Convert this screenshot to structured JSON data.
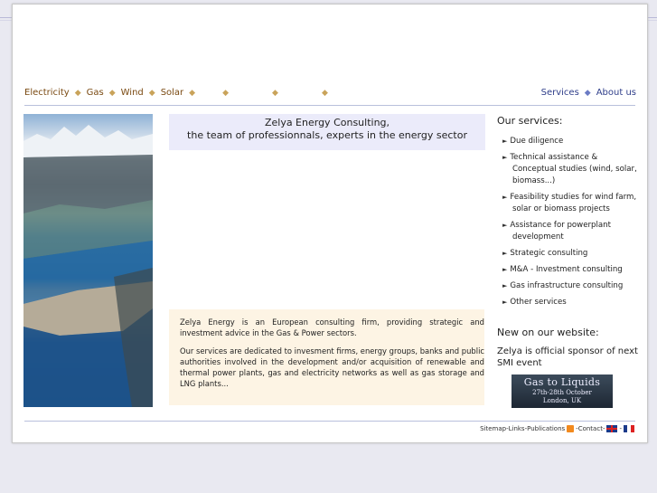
{
  "topnav": {
    "items": [
      "Electricity",
      "Gas",
      "Wind",
      "Solar"
    ]
  },
  "rightnav": {
    "services": "Services",
    "about": "About us"
  },
  "header": {
    "line1": "Zelya Energy Consulting,",
    "line2": "the team of professionnals, experts in the energy sector"
  },
  "intro": {
    "p1": "Zelya Energy is an European consulting firm, providing strategic and investment advice in the Gas & Power sectors.",
    "p2": "Our services are dedicated to invesment firms, energy groups, banks and public authorities involved in the development and/or acquisition of renewable and thermal power plants, gas and electricity networks as well as gas storage and LNG plants..."
  },
  "services": {
    "title": "Our services:",
    "items": [
      {
        "label": "Due diligence"
      },
      {
        "label": "Technical assistance & Conceptual studies",
        "extra": " (wind, solar, biomass...)"
      },
      {
        "label": "Feasibility studies for wind farm, solar or biomass projects"
      },
      {
        "label": "Assistance for powerplant development"
      },
      {
        "label": "Strategic consulting"
      },
      {
        "label": "M&A - Investment consulting"
      },
      {
        "label": "Gas infrastructure consulting"
      },
      {
        "label": "Other services"
      }
    ]
  },
  "news": {
    "title": "New on our website:",
    "sponsor_text": "Zelya is official sponsor of next SMI event",
    "banner_title": "Gas to Liquids",
    "banner_date": "27th-28th October",
    "banner_place": "London, UK"
  },
  "footer": {
    "sitemap": "Sitemap",
    "links": "Links",
    "publications": "Publications",
    "contact": "Contact",
    "sep": " - "
  },
  "colors": {
    "nav_link": "#7a4a12",
    "right_link": "#2f3e8a",
    "header_bg": "#ebebfa",
    "intro_bg": "#fdf4e4"
  }
}
